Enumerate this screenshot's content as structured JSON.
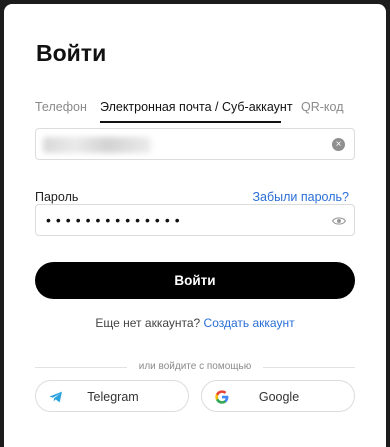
{
  "header": {
    "title": "Войти"
  },
  "tabs": [
    {
      "label": "Телефон"
    },
    {
      "label": "Электронная почта / Суб-аккаунт"
    },
    {
      "label": "QR-код"
    }
  ],
  "active_tab": "Электронная почта / Суб-аккаунт",
  "email_field": {
    "value": ""
  },
  "password": {
    "label": "Пароль",
    "forgot_link": "Забыли пароль?",
    "masked_value": "••••••••••••••"
  },
  "login_button": {
    "label": "Войти"
  },
  "signup": {
    "prompt": "Еще нет аккаунта?",
    "link": "Создать аккаунт"
  },
  "divider_text": "или войдите с помощью",
  "social": [
    {
      "label": "Telegram",
      "icon": "telegram-icon"
    },
    {
      "label": "Google",
      "icon": "google-icon"
    }
  ],
  "colors": {
    "accent": "#2a6fd6",
    "primary_button": "#000000",
    "telegram": "#2aa3de"
  }
}
